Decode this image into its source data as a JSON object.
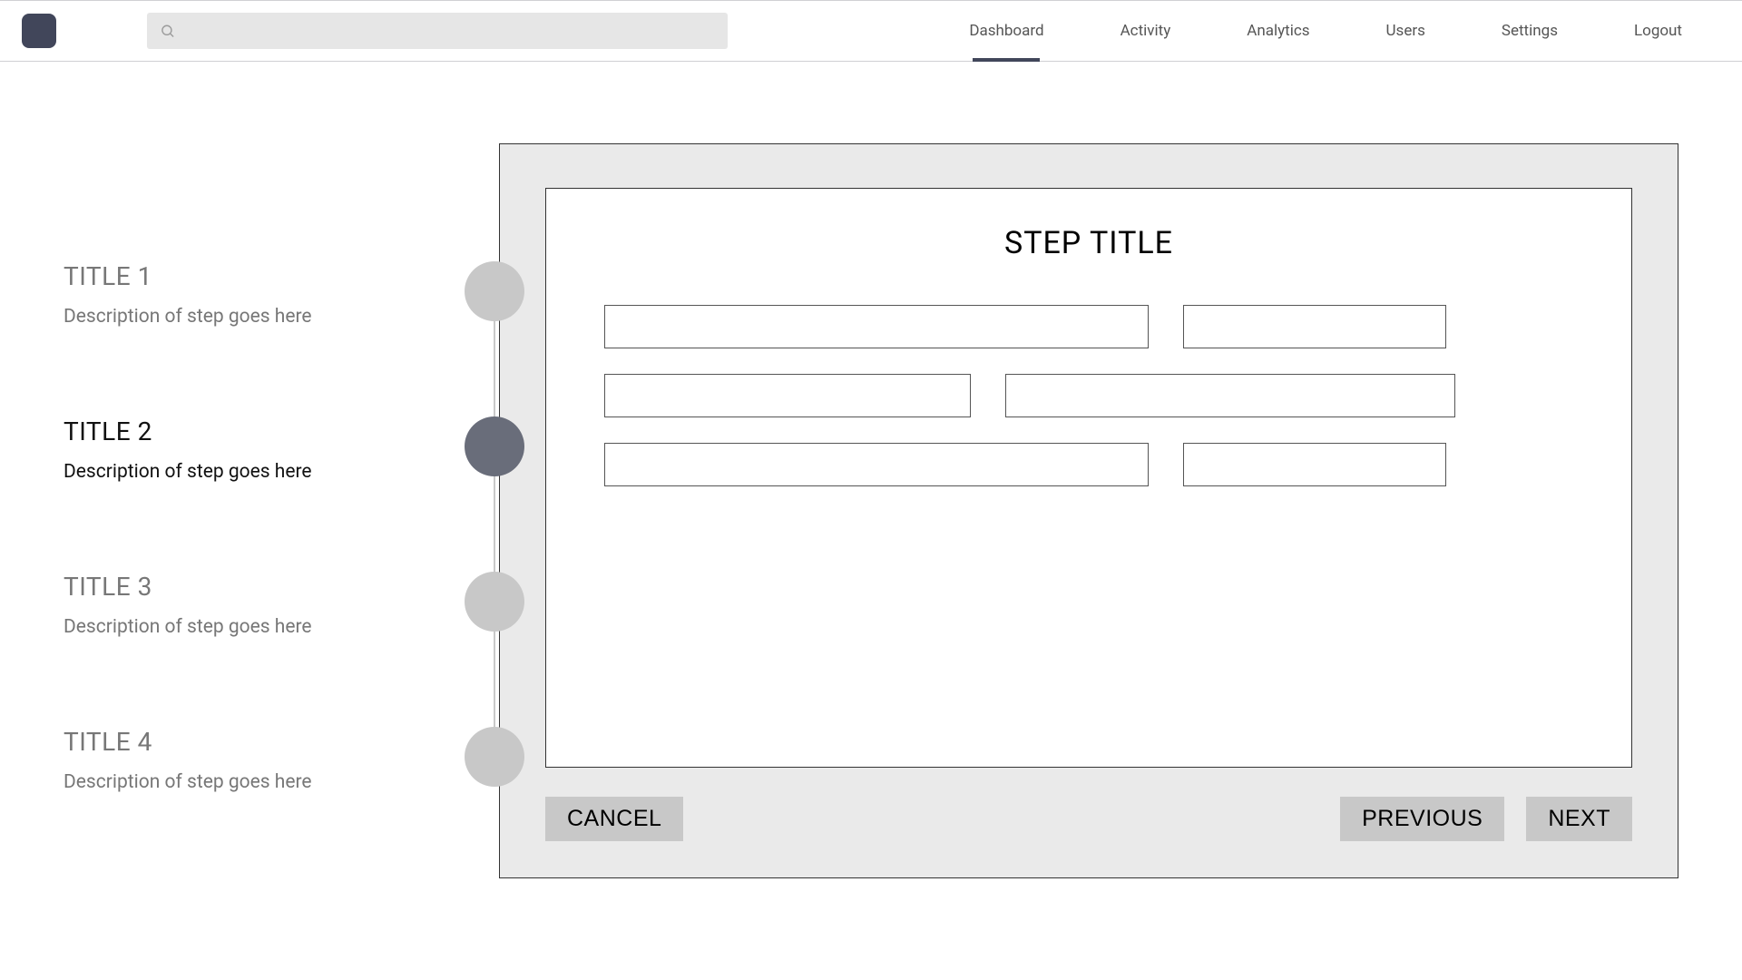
{
  "header": {
    "nav": [
      {
        "label": "Dashboard",
        "active": true
      },
      {
        "label": "Activity",
        "active": false
      },
      {
        "label": "Analytics",
        "active": false
      },
      {
        "label": "Users",
        "active": false
      },
      {
        "label": "Settings",
        "active": false
      },
      {
        "label": "Logout",
        "active": false
      }
    ],
    "search_placeholder": ""
  },
  "steps": [
    {
      "title": "TITLE 1",
      "desc": "Description of step goes here",
      "active": false
    },
    {
      "title": "TITLE 2",
      "desc": "Description of step goes here",
      "active": true
    },
    {
      "title": "TITLE 3",
      "desc": "Description of step goes here",
      "active": false
    },
    {
      "title": "TITLE 4",
      "desc": "Description of step goes here",
      "active": false
    }
  ],
  "form": {
    "title": "STEP TITLE",
    "buttons": {
      "cancel": "CANCEL",
      "previous": "PREVIOUS",
      "next": "NEXT"
    }
  }
}
